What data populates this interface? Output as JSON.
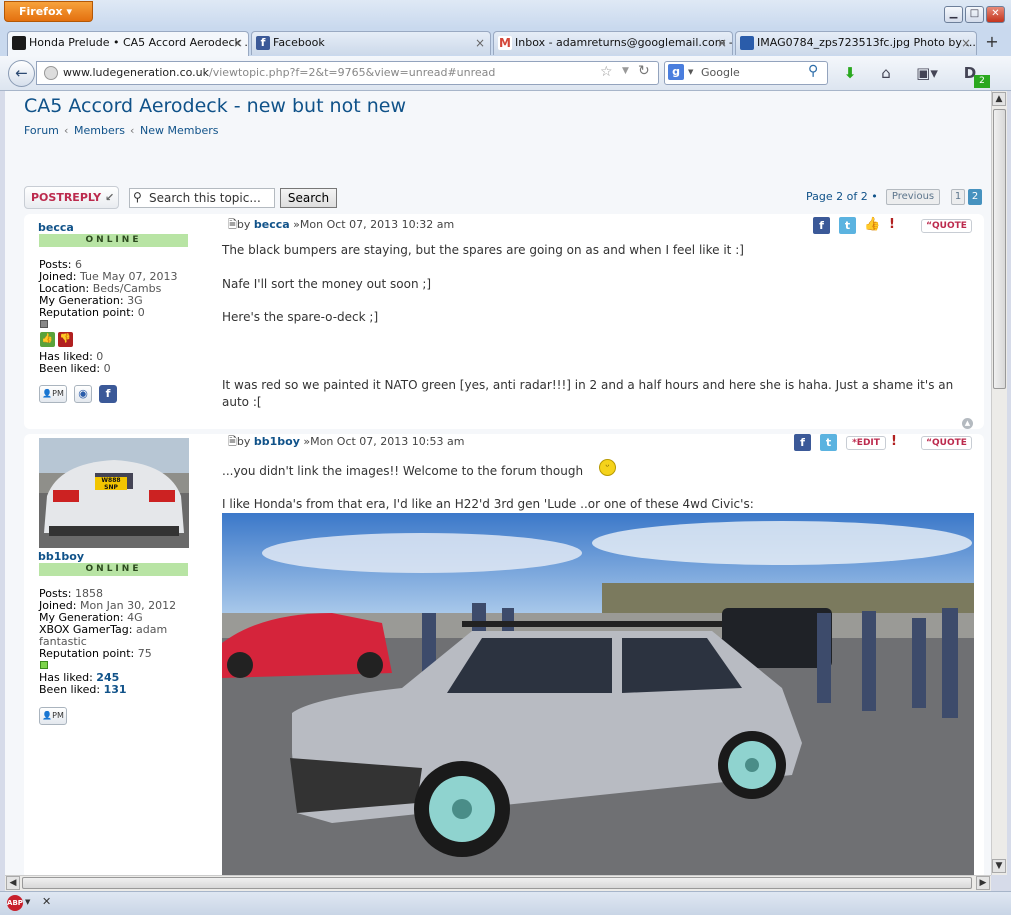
{
  "browser": {
    "app_button": "Firefox",
    "tabs": [
      {
        "title": "Honda Prelude • CA5 Accord Aerodeck ...",
        "fav_color": "#1a1a1a"
      },
      {
        "title": "Facebook",
        "fav_color": "#3b5998"
      },
      {
        "title": "Inbox - adamreturns@googlemail.com - ...",
        "fav_color": "#d44638"
      },
      {
        "title": "IMAG0784_zps723513fc.jpg Photo by ...",
        "fav_color": "#2a5caa"
      }
    ],
    "url_domain": "www.ludegeneration.co.uk",
    "url_path": "/viewtopic.php?f=2&t=9765&view=unread#unread",
    "search_placeholder": "Google",
    "badge_count": "2"
  },
  "page": {
    "title": "CA5 Accord Aerodeck - new but not new",
    "breadcrumb": [
      "Forum",
      "Members",
      "New Members"
    ],
    "post_reply_label": "POSTREPLY",
    "search_placeholder": "Search this topic...",
    "search_button": "Search",
    "pagination": {
      "text": "Page 2 of 2 •",
      "previous": "Previous",
      "pages": [
        "1",
        "2"
      ],
      "current": "2"
    }
  },
  "posts": [
    {
      "author": "becca",
      "status": "ONLINE",
      "meta": "by",
      "date": "»Mon Oct 07, 2013 10:32 am",
      "stats": [
        {
          "k": "Posts:",
          "v": "6"
        },
        {
          "k": "Joined:",
          "v": "Tue May 07, 2013"
        },
        {
          "k": "Location:",
          "v": "Beds/Cambs"
        },
        {
          "k": "My Generation:",
          "v": "3G"
        },
        {
          "k": "Reputation point:",
          "v": "0"
        }
      ],
      "has_liked": {
        "k": "Has liked:",
        "v": "0"
      },
      "been_liked": {
        "k": "Been liked:",
        "v": "0"
      },
      "quote_label": "QUOTE",
      "body": [
        "The black bumpers are staying, but the spares are going on as and when I feel like it :]",
        "Nafe I'll sort the money out soon ;]",
        "Here's the spare-o-deck ;]",
        "It was red so we painted it NATO green [yes, anti radar!!!] in 2 and a half hours and here she is haha. Just a shame it's an auto :["
      ]
    },
    {
      "author": "bb1boy",
      "status": "ONLINE",
      "meta": "by",
      "date": "»Mon Oct 07, 2013 10:53 am",
      "stats": [
        {
          "k": "Posts:",
          "v": "1858"
        },
        {
          "k": "Joined:",
          "v": "Mon Jan 30, 2012"
        },
        {
          "k": "My Generation:",
          "v": "4G"
        },
        {
          "k": "XBOX GamerTag:",
          "v": "adam"
        },
        {
          "k": "",
          "v": "fantastic"
        },
        {
          "k": "Reputation point:",
          "v": "75"
        }
      ],
      "has_liked": {
        "k": "Has liked:",
        "v": "245"
      },
      "been_liked": {
        "k": "Been liked:",
        "v": "131"
      },
      "edit_label": "EDIT",
      "quote_label": "QUOTE",
      "plate": "W888 SNP",
      "body": [
        "...you didn't link the images!! Welcome to the forum though",
        "I like Honda's from that era, I'd like an H22'd 3rd gen 'Lude ..or one of these 4wd Civic's:"
      ]
    }
  ],
  "colors": {
    "link": "#105289",
    "online_bg": "#b8e4a4",
    "quote_red": "#bc2a4d"
  }
}
